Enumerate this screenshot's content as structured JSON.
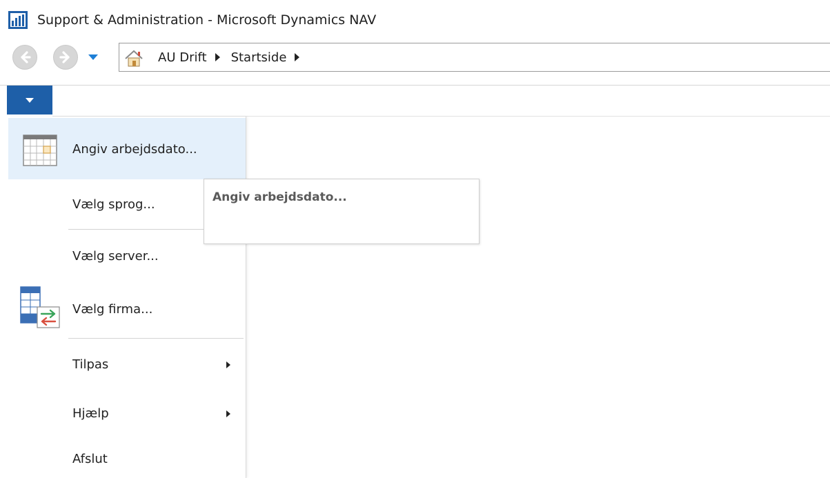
{
  "window": {
    "title": "Support & Administration - Microsoft Dynamics NAV",
    "icon": "dynamics-nav-icon"
  },
  "navigation": {
    "back_icon": "back-arrow-icon",
    "forward_icon": "forward-arrow-icon",
    "history_icon": "chevron-down-icon",
    "home_icon": "home-icon",
    "breadcrumbs": [
      {
        "label": "AU Drift"
      },
      {
        "label": "Startside"
      }
    ]
  },
  "colors": {
    "accent": "#1e5fa8",
    "highlight": "#e4f0fb",
    "tooltip_title": "#5a5a5a"
  },
  "menu": {
    "items": [
      {
        "label": "Angiv arbejdsdato...",
        "icon": "calendar-icon",
        "highlighted": true
      },
      {
        "label": "Vælg sprog..."
      },
      {
        "label": "Vælg server..."
      },
      {
        "label": "Vælg firma...",
        "icon": "switch-company-icon"
      },
      {
        "label": "Tilpas",
        "submenu": true
      },
      {
        "label": "Hjælp",
        "submenu": true
      },
      {
        "label": "Afslut"
      }
    ]
  },
  "tooltip": {
    "title": "Angiv arbejdsdato..."
  }
}
